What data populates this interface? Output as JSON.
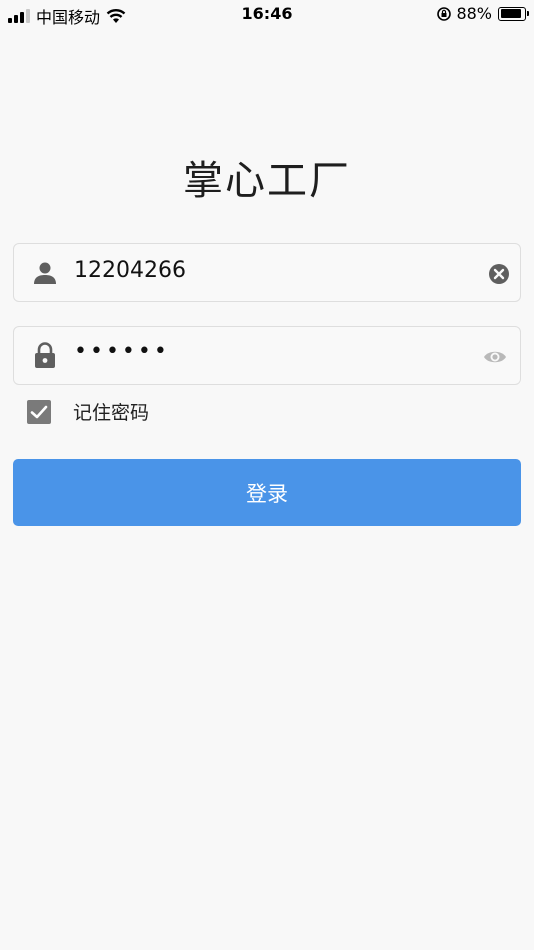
{
  "status_bar": {
    "carrier": "中国移动",
    "time": "16:46",
    "battery_percent": "88%",
    "battery_level": 0.88
  },
  "app": {
    "title": "掌心工厂"
  },
  "login_form": {
    "username": {
      "value": "12204266",
      "lead_icon": "user-icon",
      "trail_icon": "clear-icon"
    },
    "password": {
      "masked_value": "••••••",
      "lead_icon": "lock-icon",
      "trail_icon": "eye-icon"
    },
    "remember_password": {
      "label": "记住密码",
      "checked": true
    },
    "submit_label": "登录"
  },
  "colors": {
    "accent": "#4a94e8",
    "background": "#f8f8f8",
    "icon_gray": "#5f5f5f"
  }
}
